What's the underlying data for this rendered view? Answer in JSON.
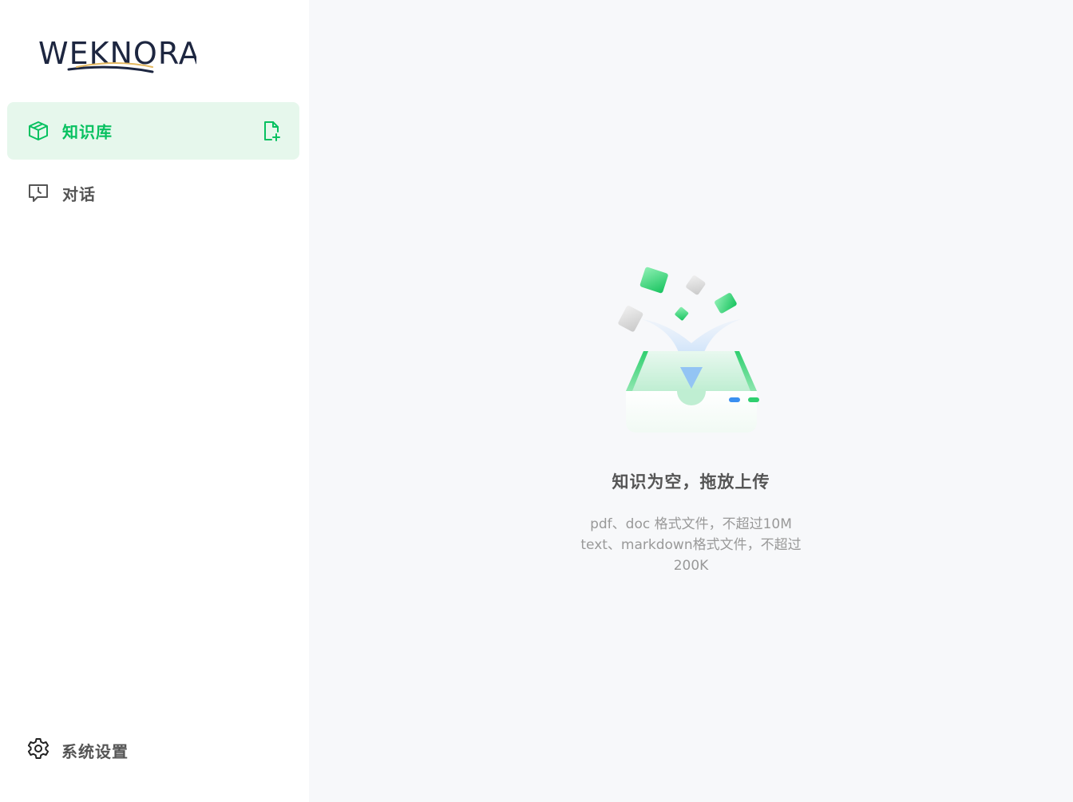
{
  "brand": {
    "logo_text": "WEKNORA"
  },
  "sidebar": {
    "items": [
      {
        "label": "知识库",
        "icon": "cube-icon",
        "active": true
      },
      {
        "label": "对话",
        "icon": "chat-clock-icon",
        "active": false
      }
    ],
    "add_doc_icon": "file-add-icon",
    "settings_label": "系统设置",
    "settings_icon": "gear-icon"
  },
  "main": {
    "empty_title": "知识为空，拖放上传",
    "empty_desc_lines": [
      "pdf、doc 格式文件，不超过10M",
      "text、markdown格式文件，不超过",
      "200K"
    ]
  },
  "colors": {
    "accent": "#07c160",
    "active_bg": "#e6f7ec",
    "text_muted": "#999999",
    "text_main": "#555555"
  }
}
